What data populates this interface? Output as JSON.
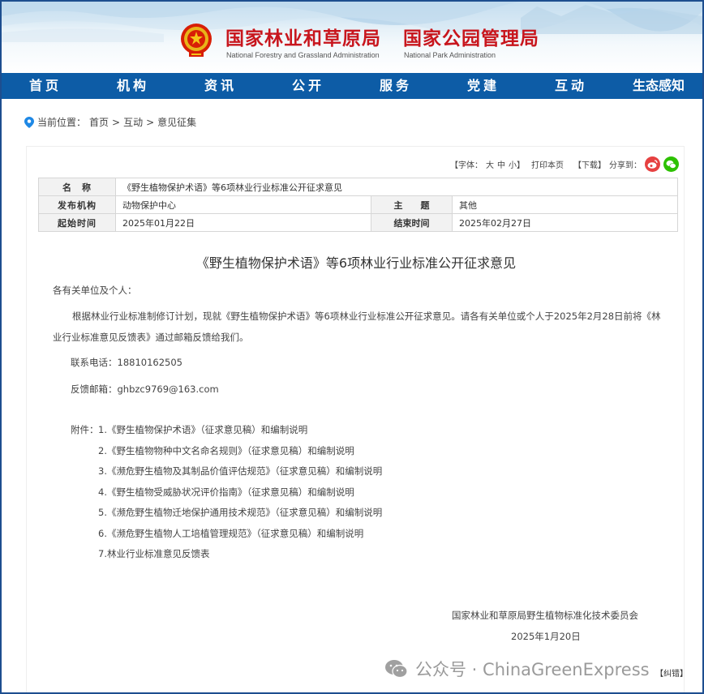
{
  "header": {
    "org1_cn": "国家林业和草原局",
    "org1_en": "National Forestry and Grassland Administration",
    "org2_cn": "国家公园管理局",
    "org2_en": "National Park Administration",
    "emblem_icon": "national-emblem-icon",
    "title_color": "#c8161d"
  },
  "nav": {
    "color": "#0d5ca6",
    "items": [
      "首页",
      "机构",
      "资讯",
      "公开",
      "服务",
      "党建",
      "互动",
      "生态感知"
    ]
  },
  "breadcrumb": {
    "prefix": "当前位置：",
    "home": "首页",
    "sep1": " > ",
    "mid": "互动",
    "sep2": " > ",
    "current": "意见征集"
  },
  "toolbar": {
    "font_label": "【字体：",
    "font_large": "大",
    "font_medium": "中",
    "font_small": "小】",
    "print": "打印本页",
    "download": "【下载】",
    "share": "分享到："
  },
  "info": {
    "name_label": "名　称",
    "name_value": "《野生植物保护术语》等6项林业行业标准公开征求意见",
    "issuer_label": "发布机构",
    "issuer_value": "动物保护中心",
    "topic_label": "主　　题",
    "topic_value": "其他",
    "start_label": "起始时间",
    "start_value": "2025年01月22日",
    "end_label": "结束时间",
    "end_value": "2025年02月27日"
  },
  "doc": {
    "title": "《野生植物保护术语》等6项林业行业标准公开征求意见",
    "greeting": "各有关单位及个人：",
    "paragraph": "根据林业行业标准制修订计划，现就《野生植物保护术语》等6项林业行业标准公开征求意见。请各有关单位或个人于2025年2月28日前将《林业行业标准意见反馈表》通过邮箱反馈给我们。",
    "phone": "联系电话：18810162505",
    "email": "反馈邮箱：ghbzc9769@163.com",
    "attach_label": "附件：",
    "attachments": [
      "1.《野生植物保护术语》（征求意见稿）和编制说明",
      "2.《野生植物物种中文名命名规则》（征求意见稿）和编制说明",
      "3.《濒危野生植物及其制品价值评估规范》（征求意见稿）和编制说明",
      "4.《野生植物受威胁状况评价指南》（征求意见稿）和编制说明",
      "5.《濒危野生植物迁地保护通用技术规范》（征求意见稿）和编制说明",
      "6.《濒危野生植物人工培植管理规范》（征求意见稿）和编制说明",
      "7.林业行业标准意见反馈表"
    ],
    "signer": "国家林业和草原局野生植物标准化技术委员会",
    "date": "2025年1月20日"
  },
  "watermark": {
    "text": "公众号 · ChinaGreenExpress",
    "corner": "【纠错】"
  }
}
